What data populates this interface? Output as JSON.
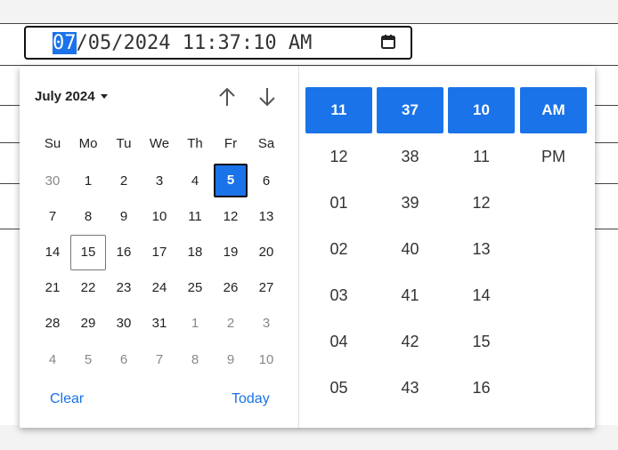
{
  "input": {
    "month": "07",
    "rest": "/05/2024 11:37:10 AM"
  },
  "calendar": {
    "month_label": "July 2024",
    "weekdays": [
      "Su",
      "Mo",
      "Tu",
      "We",
      "Th",
      "Fr",
      "Sa"
    ],
    "weeks": [
      [
        "30",
        "1",
        "2",
        "3",
        "4",
        "5",
        "6"
      ],
      [
        "7",
        "8",
        "9",
        "10",
        "11",
        "12",
        "13"
      ],
      [
        "14",
        "15",
        "16",
        "17",
        "18",
        "19",
        "20"
      ],
      [
        "21",
        "22",
        "23",
        "24",
        "25",
        "26",
        "27"
      ],
      [
        "28",
        "29",
        "30",
        "31",
        "1",
        "2",
        "3"
      ],
      [
        "4",
        "5",
        "6",
        "7",
        "8",
        "9",
        "10"
      ]
    ],
    "clear_label": "Clear",
    "today_label": "Today"
  },
  "time": {
    "hours": [
      "11",
      "12",
      "01",
      "02",
      "03",
      "04",
      "05"
    ],
    "minutes": [
      "37",
      "38",
      "39",
      "40",
      "41",
      "42",
      "43"
    ],
    "seconds": [
      "10",
      "11",
      "12",
      "13",
      "14",
      "15",
      "16"
    ],
    "ampm": [
      "AM",
      "PM"
    ]
  },
  "colors": {
    "accent": "#1a73e8",
    "text": "#222222",
    "muted": "#888888"
  }
}
